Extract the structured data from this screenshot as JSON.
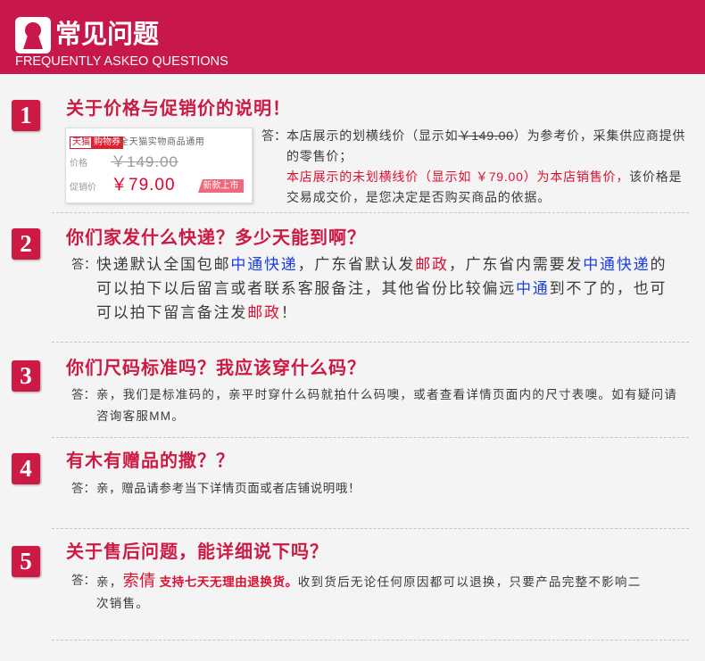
{
  "header": {
    "title": "常见问题",
    "subtitle": "FREQUENTLY ASKEO QUESTIONS",
    "logo_icon": "keyhole-logo-icon"
  },
  "theme": {
    "header_bg": "#c8174a",
    "accent": "#cc1a44",
    "highlight_red": "#dc0f32",
    "highlight_blue": "#1a3fe8",
    "text": "#333333",
    "page_bg": "#f4f4f4"
  },
  "answer_label": "答：",
  "faqs": [
    {
      "number": "1",
      "question": "关于价格与促销价的说明！",
      "price_example": {
        "tmall_tag": "天猫",
        "coupon_tag": "购物券",
        "coupon_note": "全天猫实物商品通用",
        "price_label": "价格",
        "price": "￥149.00",
        "promo_label": "促销价",
        "promo_price": "￥79.00",
        "new_tag": "新款上市"
      },
      "answer": [
        [
          "本店展示的划横线价（显示如",
          "￥149.00",
          "）为参考价，采集供应商提供"
        ],
        [
          "的零售价；"
        ],
        [
          "本店展示的未划横线价（显示如 ￥79.00）为本店销售价，",
          "该价格是"
        ],
        [
          "交易成交价，是您决定是否购买商品的依据。"
        ]
      ]
    },
    {
      "number": "2",
      "question": "你们家发什么快递？多少天能到啊？",
      "answer": [
        [
          "快递默认全国包邮",
          "中通快递",
          "，广东省默认发",
          "邮政",
          "，广东省内需要发",
          "中通快递",
          "的"
        ],
        [
          "可以拍下以后留言或者联系客服备注，其他省份比较偏远",
          "中通",
          "到不了的，也可"
        ],
        [
          "可以拍下留言备注发",
          "邮政",
          "！"
        ]
      ]
    },
    {
      "number": "3",
      "question": "你们尺码标准吗？我应该穿什么码？",
      "answer": [
        [
          "亲，我们是标准码的，亲平时穿什么码就拍什么码噢，或者查看详情页面内的尺寸表噢。如有疑问请"
        ],
        [
          "咨询客服MM。"
        ]
      ]
    },
    {
      "number": "4",
      "question": "有木有赠品的撒？？",
      "answer": [
        [
          "亲，赠品请参考当下详情页面或者店铺说明哦！"
        ]
      ]
    },
    {
      "number": "5",
      "question": "关于售后问题，能详细说下吗？",
      "answer": [
        [
          "亲，",
          "索倩",
          "支持七天无理由退换货。",
          "收到货后无论任何原因都可以退换，只要产品完整不影响二"
        ],
        [
          "次销售。"
        ]
      ]
    }
  ]
}
